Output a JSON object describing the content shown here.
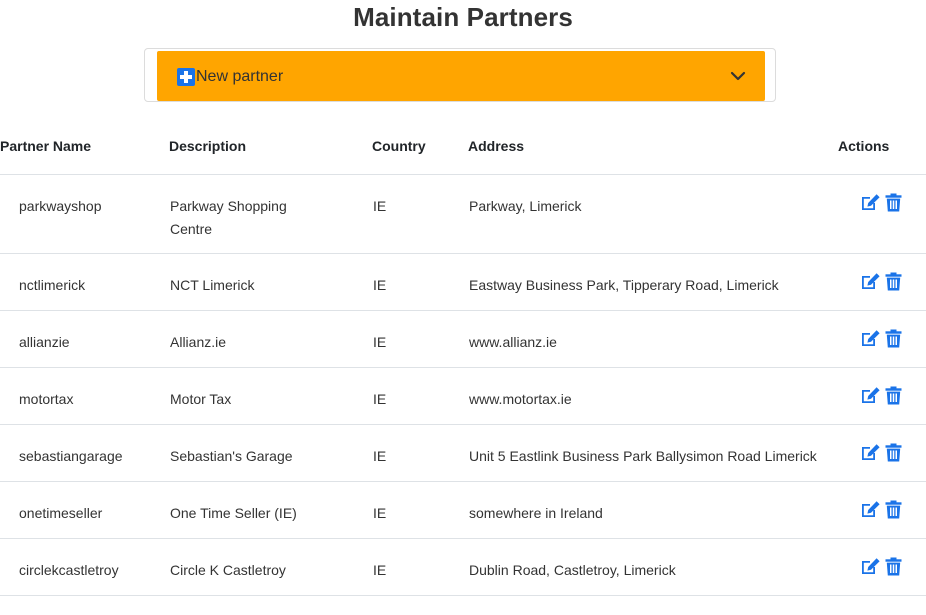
{
  "page": {
    "title": "Maintain Partners"
  },
  "new_partner": {
    "label": "New partner"
  },
  "table": {
    "headers": {
      "name": "Partner Name",
      "description": "Description",
      "country": "Country",
      "address": "Address",
      "actions": "Actions"
    },
    "rows": [
      {
        "name": "parkwayshop",
        "description": "Parkway Shopping Centre",
        "country": "IE",
        "address": "Parkway, Limerick"
      },
      {
        "name": "nctlimerick",
        "description": "NCT Limerick",
        "country": "IE",
        "address": "Eastway Business Park, Tipperary Road, Limerick"
      },
      {
        "name": "allianzie",
        "description": "Allianz.ie",
        "country": "IE",
        "address": "www.allianz.ie"
      },
      {
        "name": "motortax",
        "description": "Motor Tax",
        "country": "IE",
        "address": "www.motortax.ie"
      },
      {
        "name": "sebastiangarage",
        "description": "Sebastian's Garage",
        "country": "IE",
        "address": "Unit 5 Eastlink Business Park Ballysimon Road Limerick"
      },
      {
        "name": "onetimeseller",
        "description": "One Time Seller (IE)",
        "country": "IE",
        "address": "somewhere in Ireland"
      },
      {
        "name": "circlekcastletroy",
        "description": "Circle K Castletroy",
        "country": "IE",
        "address": "Dublin Road, Castletroy, Limerick"
      }
    ]
  },
  "colors": {
    "accent": "#ffa500",
    "icon_blue": "#1a73e8",
    "border": "#dee2e6"
  },
  "icons": {
    "add": "plus-square-icon",
    "expand": "chevron-down-icon",
    "edit": "edit-icon",
    "delete": "trash-icon"
  }
}
